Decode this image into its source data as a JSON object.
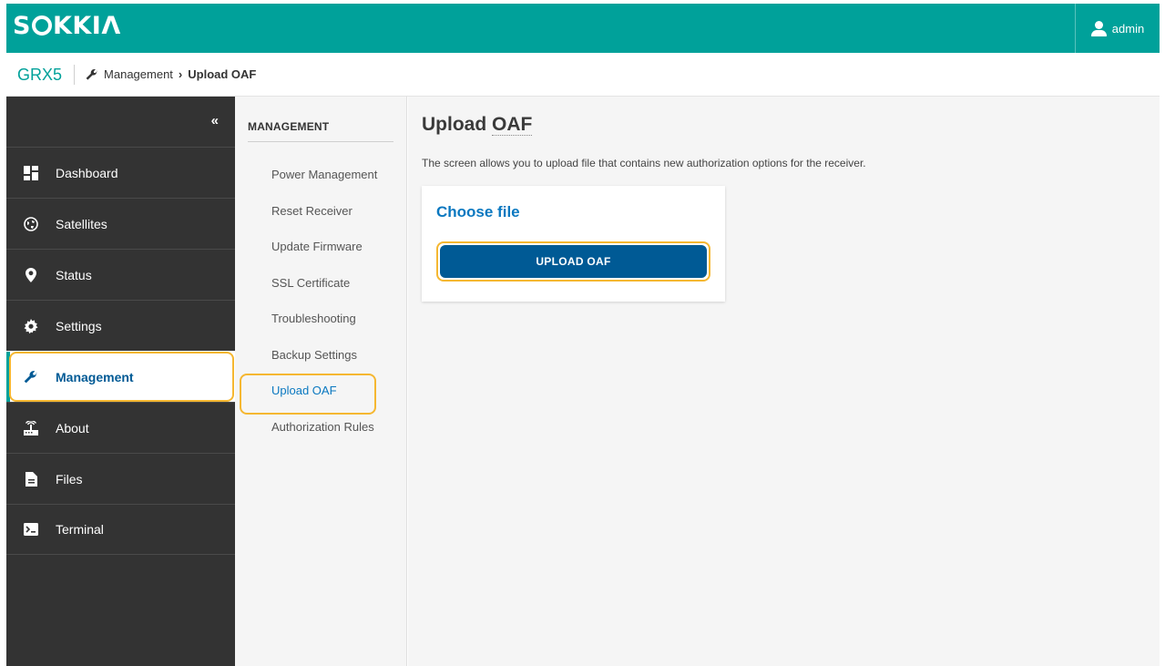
{
  "header": {
    "logo_text": "SOKKIA",
    "logo_prefix": "S",
    "logo_suffix": "KKIΛ",
    "user_label": "admin",
    "user_icon": "user-icon"
  },
  "breadcrumb": {
    "model": "GRX5",
    "icon": "wrench-icon",
    "parent": "Management",
    "separator": "›",
    "current": "Upload OAF"
  },
  "sidebar": {
    "collapse_glyph": "«",
    "items": [
      {
        "label": "Dashboard",
        "icon": "dashboard-icon"
      },
      {
        "label": "Satellites",
        "icon": "globe-icon"
      },
      {
        "label": "Status",
        "icon": "location-pin-icon"
      },
      {
        "label": "Settings",
        "icon": "gear-icon"
      },
      {
        "label": "Management",
        "icon": "wrench-icon",
        "active": true
      },
      {
        "label": "About",
        "icon": "receiver-icon"
      },
      {
        "label": "Files",
        "icon": "file-icon"
      },
      {
        "label": "Terminal",
        "icon": "terminal-icon"
      }
    ]
  },
  "submenu": {
    "title": "MANAGEMENT",
    "items": [
      {
        "label": "Power Management"
      },
      {
        "label": "Reset Receiver"
      },
      {
        "label": "Update Firmware"
      },
      {
        "label": "SSL Certificate"
      },
      {
        "label": "Troubleshooting"
      },
      {
        "label": "Backup Settings"
      },
      {
        "label": "Upload OAF",
        "active": true
      },
      {
        "label": "Authorization Rules"
      }
    ]
  },
  "main": {
    "title": "Upload OAF",
    "title_plain": "Upload ",
    "title_dotted": "OAF",
    "description": "The screen allows you to upload file that contains new authorization options for the receiver.",
    "card": {
      "title": "Choose file",
      "button_label": "UPLOAD OAF"
    }
  },
  "colors": {
    "brand_teal": "#00a19a",
    "sidebar_bg": "#333333",
    "primary_blue": "#005a95",
    "link_blue": "#0a78c0",
    "highlight": "#f5b731"
  }
}
